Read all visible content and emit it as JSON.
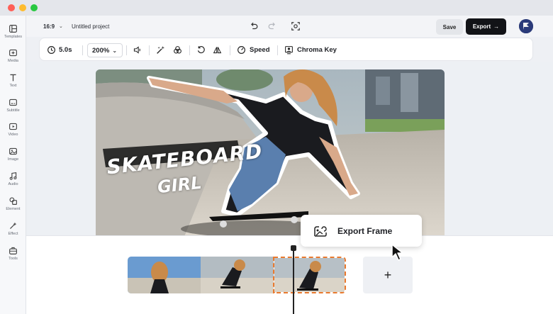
{
  "window": {
    "buttons": [
      "close",
      "minimize",
      "maximize"
    ]
  },
  "sidebar": {
    "items": [
      {
        "label": "Templates",
        "icon": "templates-icon"
      },
      {
        "label": "Media",
        "icon": "media-icon"
      },
      {
        "label": "Text",
        "icon": "text-icon"
      },
      {
        "label": "Subtitle",
        "icon": "subtitle-icon"
      },
      {
        "label": "Video",
        "icon": "video-icon"
      },
      {
        "label": "Image",
        "icon": "image-icon"
      },
      {
        "label": "Audio",
        "icon": "audio-icon"
      },
      {
        "label": "Element",
        "icon": "element-icon"
      },
      {
        "label": "Effect",
        "icon": "effect-icon"
      },
      {
        "label": "Tools",
        "icon": "tools-icon"
      }
    ]
  },
  "topbar": {
    "aspect_ratio": "16:9",
    "project_name": "Untitled project",
    "save_label": "Save",
    "export_label": "Export"
  },
  "toolbar": {
    "duration": "5.0s",
    "zoom": "200%",
    "speed_label": "Speed",
    "chroma_key_label": "Chroma Key"
  },
  "canvas": {
    "title_line1": "SKATEBOARD",
    "title_line2": "GIRL"
  },
  "popup": {
    "label": "Export Frame"
  },
  "timeline": {
    "add_label": "+"
  },
  "colors": {
    "accent_dark": "#121317",
    "selected_clip_border": "#e97a2f",
    "background": "#eef0f4"
  }
}
